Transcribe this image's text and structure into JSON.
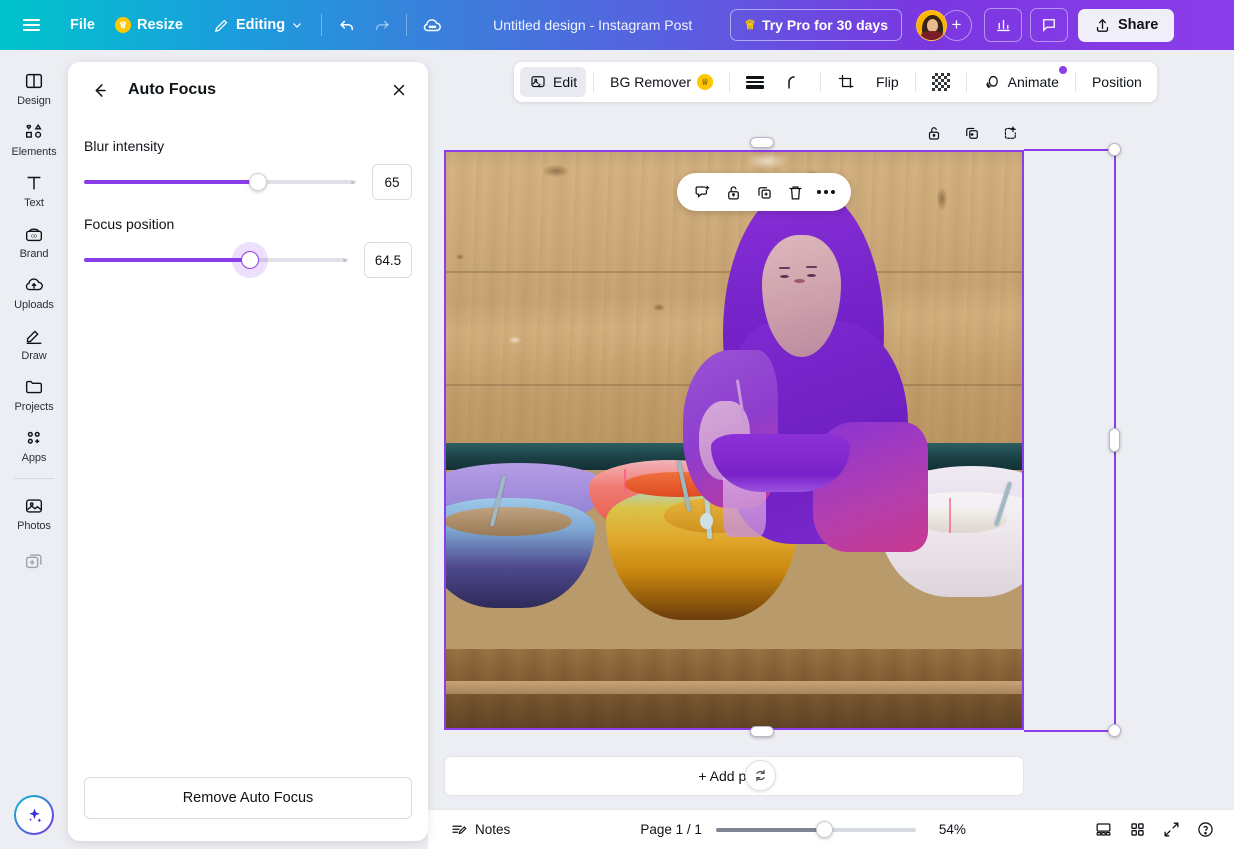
{
  "header": {
    "menu_icon": "hamburger-icon",
    "file_label": "File",
    "resize_label": "Resize",
    "editing_label": "Editing",
    "undo_icon": "undo-icon",
    "redo_icon": "redo-icon",
    "cloud_icon": "cloud-saving-icon",
    "doc_title": "Untitled design - Instagram Post",
    "try_pro_label": "Try Pro for 30 days",
    "crown_icon": "crown-icon",
    "avatar": "user-avatar",
    "add_member_icon": "plus-icon",
    "insights_icon": "bar-chart-icon",
    "comments_icon": "speech-bubble-icon",
    "share_label": "Share",
    "share_icon": "upload-icon"
  },
  "sidebar": {
    "items": [
      {
        "label": "Design",
        "icon": "design-panel-icon"
      },
      {
        "label": "Elements",
        "icon": "shapes-icon"
      },
      {
        "label": "Text",
        "icon": "text-t-icon"
      },
      {
        "label": "Brand",
        "icon": "brand-kit-icon"
      },
      {
        "label": "Uploads",
        "icon": "upload-cloud-icon"
      },
      {
        "label": "Draw",
        "icon": "pencil-draw-icon"
      },
      {
        "label": "Projects",
        "icon": "folder-icon"
      },
      {
        "label": "Apps",
        "icon": "apps-grid-plus-icon"
      },
      {
        "label": "Photos",
        "icon": "photo-image-icon"
      }
    ],
    "more_icon": "add-stacked-icon",
    "magic_icon": "magic-sparkle-icon"
  },
  "panel": {
    "title": "Auto Focus",
    "back_icon": "arrow-left-icon",
    "close_icon": "close-x-icon",
    "controls": [
      {
        "label": "Blur intensity",
        "value": "65",
        "percent": 64,
        "active": false
      },
      {
        "label": "Focus position",
        "value": "64.5",
        "percent": 63,
        "active": true
      }
    ],
    "remove_label": "Remove Auto Focus"
  },
  "toolbar": {
    "edit_label": "Edit",
    "edit_icon": "image-edit-icon",
    "bg_remover_label": "BG Remover",
    "bg_remover_badge": "crown-icon",
    "adjust_icon": "horizontal-lines-icon",
    "corner_icon": "rounded-corner-icon",
    "crop_icon": "crop-icon",
    "flip_label": "Flip",
    "transparency_icon": "transparency-checker-icon",
    "animate_label": "Animate",
    "animate_icon": "animate-circles-icon",
    "animate_badge": true,
    "position_label": "Position"
  },
  "page_tools": {
    "lock_icon": "lock-open-icon",
    "duplicate_icon": "duplicate-page-icon",
    "add_page_icon": "add-page-icon"
  },
  "context_toolbar": {
    "comment_icon": "add-comment-icon",
    "lock_icon": "lock-open-icon",
    "duplicate_icon": "duplicate-icon",
    "delete_icon": "trash-icon",
    "more_icon": "more-dots-icon"
  },
  "canvas": {
    "add_page_label": "+ Add page",
    "loading_cursor": "spinner-cursor",
    "selection_color": "#8b3dea",
    "subject_overlay_color": "#7c28cf",
    "image_description": "Woman in hijab preparing food beside plastic bowls of curry on a wooden counter"
  },
  "statusbar": {
    "notes_label": "Notes",
    "notes_icon": "notes-icon",
    "page_count": "Page 1 / 1",
    "zoom_percent": "54%",
    "zoom_value": 54,
    "grid_view_icon": "page-view-icon",
    "thumbnails_icon": "grid-view-icon",
    "fullscreen_icon": "expand-icon",
    "help_icon": "question-mark-icon"
  }
}
